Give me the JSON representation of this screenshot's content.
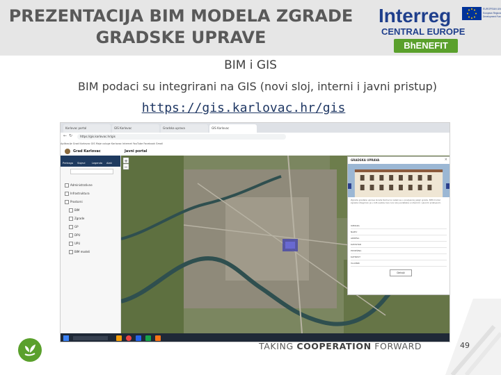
{
  "header": {
    "title_line1": "PREZENTACIJA BIM MODELA ZGRADE",
    "title_line2": "GRADSKE UPRAVE",
    "logo": {
      "interreg": "Interreg",
      "region": "CENTRAL EUROPE",
      "project": "BhENEFIT",
      "fund_text": "EUROPEAN UNION European Regional Development Fund"
    }
  },
  "subtitle": "BIM i GIS",
  "description": "BIM podaci su integrirani na GIS (novi sloj, interni i javni pristup)",
  "link": "https://gis.karlovac.hr/gis",
  "screenshot": {
    "tabs": [
      "Karlovac portal",
      "GIS Karlovac",
      "Gradska uprava",
      "GIS Karlovac"
    ],
    "address": "https://gis.karlovac.hr/gis",
    "bookmarks": "Aplikacije   Grad Karlovac   GIS   Moje usluge   Karlovac   Internet   YouTube   Facebook   Gmail",
    "app_name": "Grad Karlovac",
    "app_section": "Javni portal",
    "sidebar_tabs": [
      "Pretraga",
      "Slojevi",
      "Legenda",
      "Alati"
    ],
    "layers": [
      "Administrativne",
      "Infrastruktura",
      "Prostorni",
      "BIM",
      "Zgrade",
      "GP",
      "DPU",
      "UPU",
      "BIM modeli"
    ],
    "popup_title": "GRADSKA UPRAVA",
    "popup_rows": [
      "OZNAKA",
      "NAZIV",
      "ADRESA",
      "KATASTAR",
      "POVRŠINA",
      "KATNOST",
      "VLASNIK"
    ],
    "popup_text": "Zgrada gradske uprave Grada Karlovca nalazi se u povijesnoj jezgri grada. BIM model zgrade integriran je u GIS sustav kao novi sloj podataka s internim i javnim pristupom.",
    "popup_button": "Detalji"
  },
  "footer": {
    "text_prefix": "TAKING ",
    "text_bold": "COOPERATION",
    "text_suffix": " FORWARD",
    "page_number": "49"
  },
  "colors": {
    "header_bg": "#e6e6e6",
    "interreg_blue": "#1f3f8c",
    "bhenefit_green": "#5aa02c",
    "footer_green": "#5aa02c"
  }
}
